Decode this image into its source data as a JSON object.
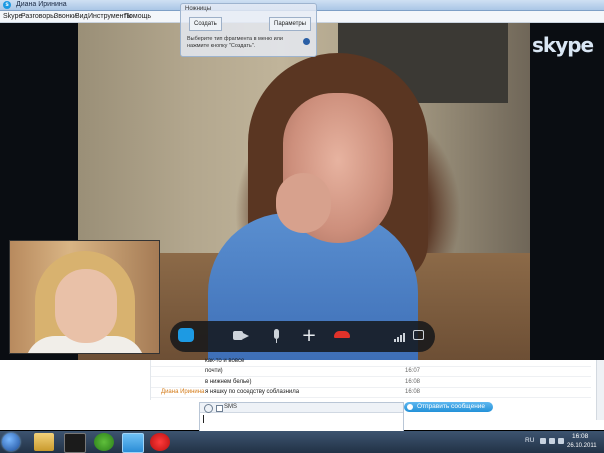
{
  "window": {
    "title": "Диана Иринина"
  },
  "menu": [
    "Skype",
    "Разговоры",
    "Звонки",
    "Вид",
    "Инструменты",
    "Помощь"
  ],
  "brand": {
    "logo_text": "skype",
    "accent": "#1d9ae3",
    "sender_color": "#d47b18",
    "hangup_color": "#e0322a"
  },
  "snipping_tool": {
    "title": "Ножницы",
    "create_label": "Создать",
    "options_label": "Параметры",
    "hint": "Выберите тип фрагмента в меню или нажмите кнопку \"Создать\"."
  },
  "call_controls": [
    "chat-icon",
    "video-icon",
    "microphone-icon",
    "plus-icon",
    "hangup-icon",
    "signal-icon",
    "fullscreen-icon"
  ],
  "chat": {
    "messages": [
      {
        "sender": "",
        "text": "как-то и вовсе",
        "time": ""
      },
      {
        "sender": "",
        "text": "почти)",
        "time": "16:07"
      },
      {
        "sender": "",
        "text": "в нижнем белье)",
        "time": "16:08"
      },
      {
        "sender": "Диана Иринина",
        "text": "я няшку по соседству соблазнила",
        "time": "16:08"
      }
    ],
    "sms_label": "SMS",
    "send_label": "Отправить сообщение"
  },
  "taskbar": {
    "language": "RU",
    "time": "16:08",
    "date": "26.10.2011"
  }
}
